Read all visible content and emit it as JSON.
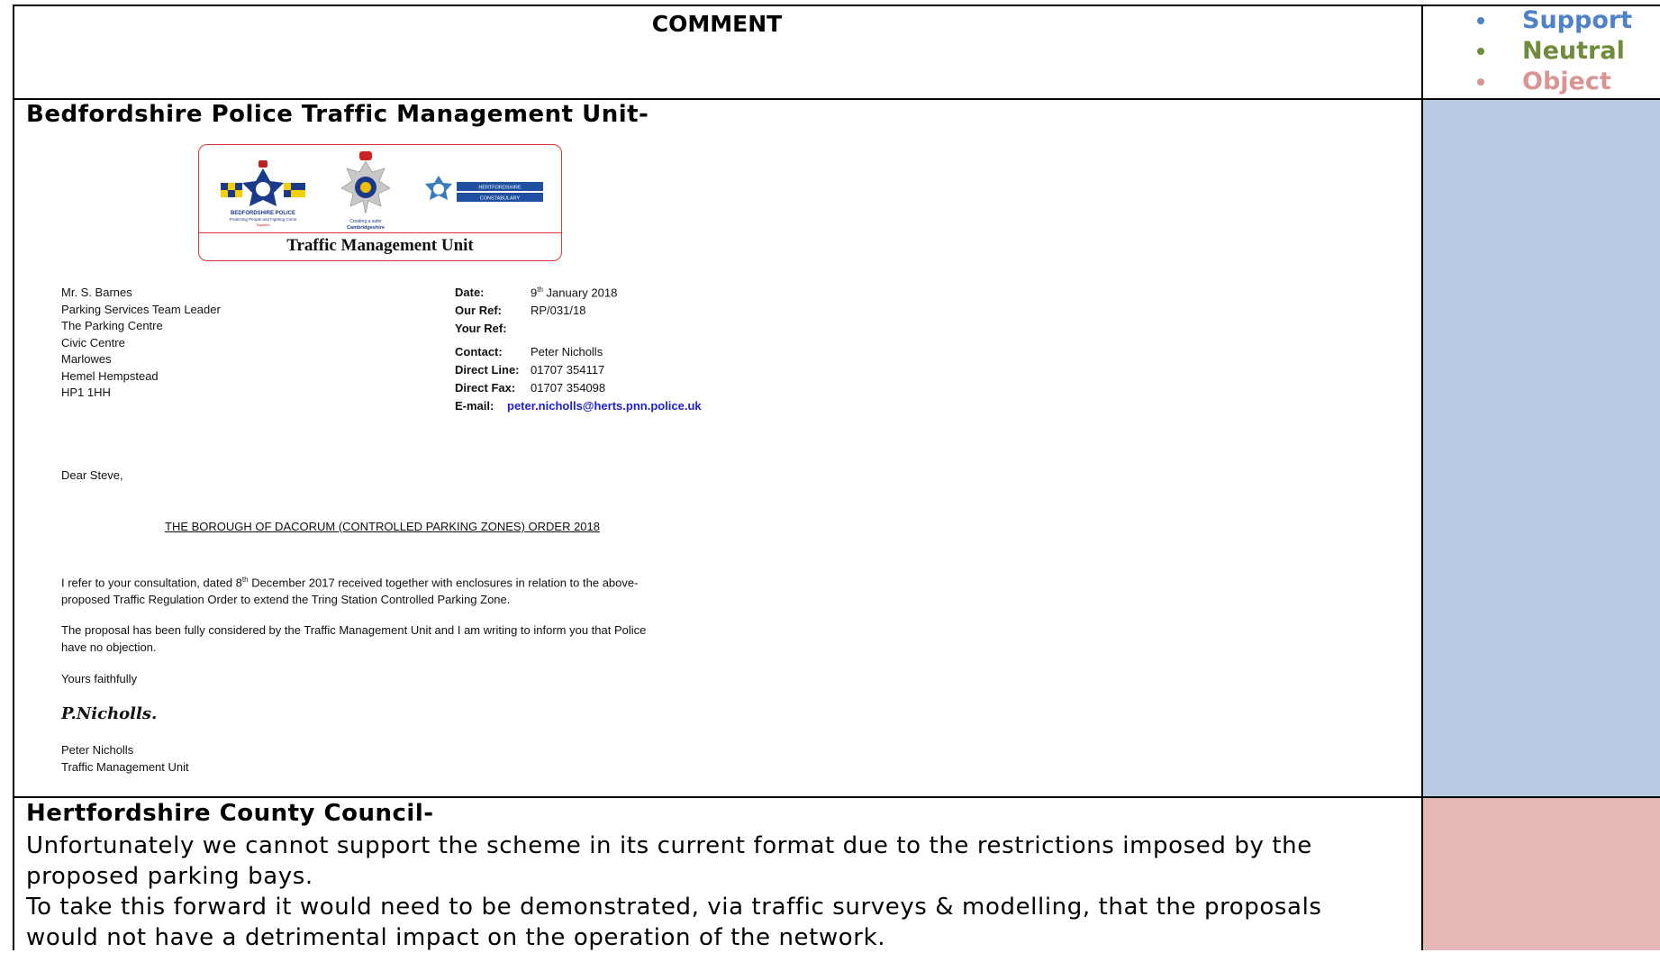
{
  "header": {
    "comment_label": "COMMENT"
  },
  "legend": [
    {
      "label": "Support",
      "color": "#4f81c7"
    },
    {
      "label": "Neutral",
      "color": "#6e8c3a"
    },
    {
      "label": "Object",
      "color": "#d99594"
    }
  ],
  "colors": {
    "support_cell": "#b8cce4",
    "object_cell": "#e6b8b7"
  },
  "sections": {
    "police": {
      "title": "Bedfordshire Police Traffic Management Unit-",
      "letter": {
        "logo_caption": "Traffic Management Unit",
        "logo_text": {
          "bedfordshire": "BEDFORDSHIRE POLICE",
          "bedfordshire_motto": "Protecting People and Fighting Crime",
          "bedfordshire_motto_2": "Together",
          "cambs_line1": "Creating a safer",
          "cambs_line2": "Cambridgeshire",
          "herts_line1": "HERTFORDSHIRE",
          "herts_line2": "CONSTABULARY"
        },
        "address_lines": [
          "Mr. S. Barnes",
          "Parking Services Team Leader",
          "The Parking Centre",
          "Civic Centre",
          "Marlowes",
          "Hemel Hempstead",
          "HP1 1HH"
        ],
        "date_label": "Date:",
        "date_day": "9",
        "date_sup": "th",
        "date_rest": " January 2018",
        "our_ref_label": "Our Ref:",
        "our_ref": "RP/031/18",
        "your_ref_label": "Your Ref:",
        "contact_label": "Contact:",
        "contact": "Peter Nicholls",
        "direct_line_label": "Direct Line:",
        "direct_line": "01707 354117",
        "direct_fax_label": "Direct Fax:",
        "direct_fax": "01707 354098",
        "email_label": "E-mail:",
        "email": "peter.nicholls@herts.pnn.police.uk",
        "salutation": "Dear Steve,",
        "order_title": "THE BOROUGH OF DACORUM (CONTROLLED PARKING ZONES) ORDER 2018",
        "para1_a": "I refer to your consultation, dated 8",
        "para1_sup": "th",
        "para1_b": " December 2017 received together with enclosures in relation to the above-",
        "para1_c": "proposed Traffic Regulation Order to extend the Tring Station Controlled Parking Zone.",
        "para2_a": "The proposal has been fully considered by the Traffic Management Unit and I am writing to inform you that Police",
        "para2_b": "have no objection.",
        "closing": "Yours faithfully",
        "signature": "P.Nicholls.",
        "sign_name": "Peter Nicholls",
        "sign_unit": "Traffic Management Unit"
      }
    },
    "hcc": {
      "title": "Hertfordshire County Council-",
      "line1": "Unfortunately we cannot support the scheme in its current format due to the restrictions imposed by the",
      "line2": "proposed parking bays.",
      "line3": "To take this forward it would need to be demonstrated, via traffic surveys & modelling, that the proposals",
      "line4": "would not have a detrimental impact on the operation of the network."
    }
  }
}
